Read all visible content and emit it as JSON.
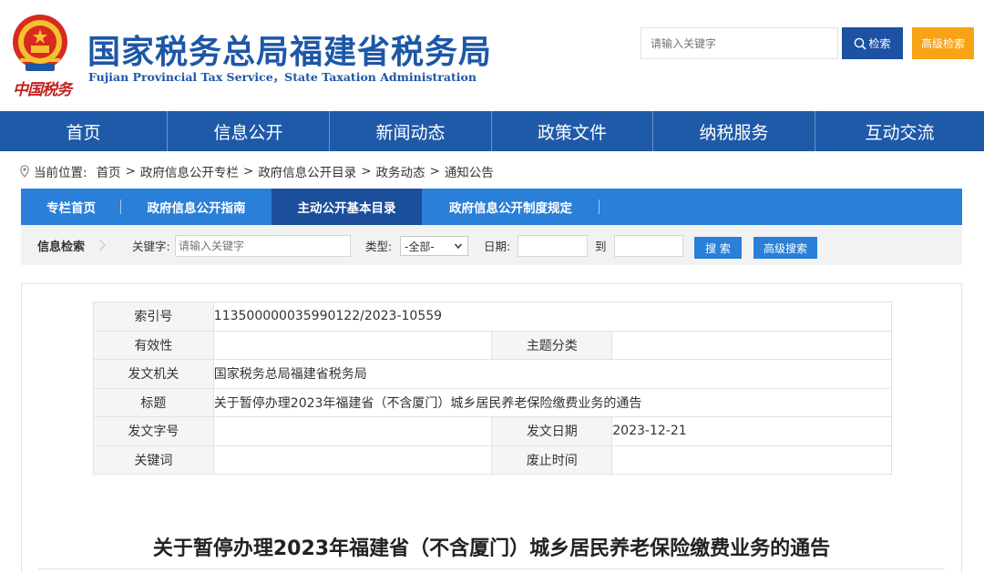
{
  "header": {
    "title": "国家税务总局福建省税务局",
    "subtitle": "Fujian Provincial Tax Service，State Taxation Administration",
    "brand_cursive": "中国税务",
    "search_placeholder": "请输入关键字",
    "search_button": "检索",
    "advanced_button": "高级检索"
  },
  "main_nav": {
    "items": [
      {
        "label": "首页"
      },
      {
        "label": "信息公开"
      },
      {
        "label": "新闻动态"
      },
      {
        "label": "政策文件"
      },
      {
        "label": "纳税服务"
      },
      {
        "label": "互动交流"
      }
    ]
  },
  "breadcrumb": {
    "prefix": "当前位置:",
    "items": [
      "首页",
      "政府信息公开专栏",
      "政府信息公开目录",
      "政务动态",
      "通知公告"
    ],
    "separator": ">"
  },
  "sub_nav": {
    "items": [
      {
        "label": "专栏首页"
      },
      {
        "label": "政府信息公开指南"
      },
      {
        "label": "主动公开基本目录"
      },
      {
        "label": "政府信息公开制度规定"
      }
    ]
  },
  "search_bar": {
    "label": "信息检索",
    "keyword_label": "关键字:",
    "keyword_placeholder": "请输入关键字",
    "type_label": "类型:",
    "type_selected": "-全部-",
    "date_label": "日期:",
    "to_label": "到",
    "search_button": "搜 索",
    "advanced_button": "高级搜索"
  },
  "meta": {
    "index_label": "索引号",
    "index_value": "113500000035990122/2023-10559",
    "validity_label": "有效性",
    "validity_value": "",
    "topic_label": "主题分类",
    "topic_value": "",
    "issuer_label": "发文机关",
    "issuer_value": "国家税务总局福建省税务局",
    "title_label": "标题",
    "title_value": "关于暂停办理2023年福建省（不含厦门）城乡居民养老保险缴费业务的通告",
    "docno_label": "发文字号",
    "docno_value": "",
    "date_label": "发文日期",
    "date_value": "2023-12-21",
    "keywords_label": "关键词",
    "keywords_value": "",
    "expiry_label": "废止时间",
    "expiry_value": ""
  },
  "article": {
    "title": "关于暂停办理2023年福建省（不含厦门）城乡居民养老保险缴费业务的通告"
  },
  "icons": {
    "emblem": "national-emblem-icon",
    "search": "search-icon",
    "location": "location-pin-icon",
    "arrow": "chevron-right-icon",
    "dropdown": "chevron-down-icon"
  },
  "colors": {
    "brand_blue": "#1d57a6",
    "nav_blue": "#1f5aa9",
    "sub_nav_blue": "#2a7fd8",
    "sub_nav_active": "#1b4e9b",
    "accent_orange": "#f8a316",
    "brand_red": "#c3201f"
  }
}
